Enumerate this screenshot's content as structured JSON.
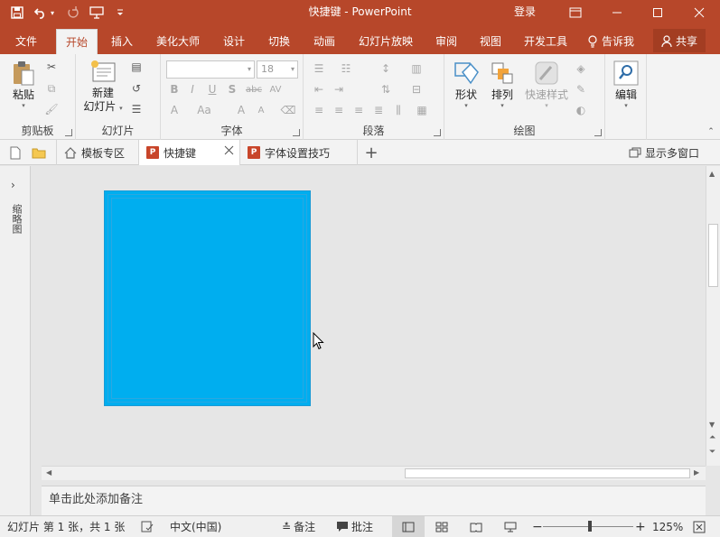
{
  "titlebar": {
    "doc_name": "快捷键",
    "separator": "-",
    "app_name": "PowerPoint",
    "login": "登录"
  },
  "tabs": [
    {
      "label": "文件",
      "active": false
    },
    {
      "label": "开始",
      "active": true
    },
    {
      "label": "插入",
      "active": false
    },
    {
      "label": "美化大师",
      "active": false
    },
    {
      "label": "设计",
      "active": false
    },
    {
      "label": "切换",
      "active": false
    },
    {
      "label": "动画",
      "active": false
    },
    {
      "label": "幻灯片放映",
      "active": false
    },
    {
      "label": "审阅",
      "active": false
    },
    {
      "label": "视图",
      "active": false
    },
    {
      "label": "开发工具",
      "active": false
    }
  ],
  "tell_me": "告诉我",
  "share": "共享",
  "ribbon": {
    "clipboard": {
      "group": "剪贴板",
      "paste": "粘贴"
    },
    "slides": {
      "group": "幻灯片",
      "new_slide_line1": "新建",
      "new_slide_line2": "幻灯片"
    },
    "font": {
      "group": "字体",
      "font_size": "18",
      "bold": "B",
      "italic": "I",
      "underline": "U",
      "shadow": "S",
      "strike": "abc",
      "spacing": "AV",
      "color": "A",
      "case": "Aa",
      "grow": "A",
      "shrink": "A"
    },
    "paragraph": {
      "group": "段落"
    },
    "drawing": {
      "group": "绘图",
      "shape": "形状",
      "arrange": "排列",
      "quick_style": "快速样式"
    },
    "editing": {
      "label": "编辑"
    }
  },
  "doctabs": [
    {
      "label": "模板专区",
      "type": "home",
      "active": false
    },
    {
      "label": "快捷键",
      "type": "ppt",
      "active": true
    },
    {
      "label": "字体设置技巧",
      "type": "ppt",
      "active": false
    }
  ],
  "multi_window": "显示多窗口",
  "left_pane_label": "缩略图",
  "notes_placeholder": "单击此处添加备注",
  "statusbar": {
    "slide_info": "幻灯片 第 1 张，共 1 张",
    "language": "中文(中国)",
    "notes": "备注",
    "comments": "批注",
    "zoom": "125%"
  },
  "colors": {
    "accent": "#b7472a",
    "slide_fill": "#00aeef"
  }
}
